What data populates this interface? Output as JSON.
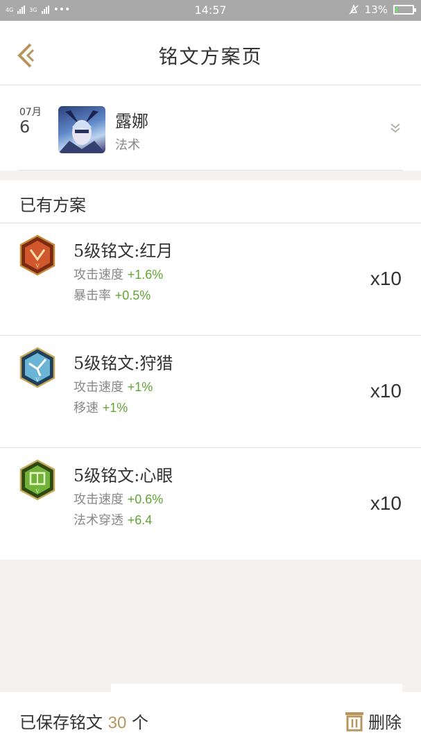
{
  "status_bar": {
    "net1": "4G",
    "net2": "3G",
    "dots": "•••",
    "time": "14:57",
    "battery": "13%",
    "battery_level": 0.13
  },
  "header": {
    "title": "铭文方案页"
  },
  "hero": {
    "month": "07月",
    "day": "6",
    "name": "露娜",
    "type": "法术"
  },
  "section": {
    "title": "已有方案"
  },
  "runes": [
    {
      "name": "5级铭文:红月",
      "color": "#c8532a",
      "stats": [
        {
          "label": "攻击速度",
          "value": "+1.6%"
        },
        {
          "label": "暴击率",
          "value": "+0.5%"
        }
      ],
      "count": "x10"
    },
    {
      "name": "5级铭文:狩猎",
      "color": "#4a9bc0",
      "stats": [
        {
          "label": "攻击速度",
          "value": "+1%"
        },
        {
          "label": "移速",
          "value": "+1%"
        }
      ],
      "count": "x10"
    },
    {
      "name": "5级铭文:心眼",
      "color": "#5e9a2c",
      "stats": [
        {
          "label": "攻击速度",
          "value": "+0.6%"
        },
        {
          "label": "法术穿透",
          "value": "+6.4"
        }
      ],
      "count": "x10"
    }
  ],
  "footer": {
    "saved_prefix": "已保存铭文",
    "saved_count": "30",
    "saved_suffix": "个",
    "delete_label": "删除"
  },
  "colors": {
    "accent": "#b8955c",
    "stat_green": "#5fa630"
  }
}
